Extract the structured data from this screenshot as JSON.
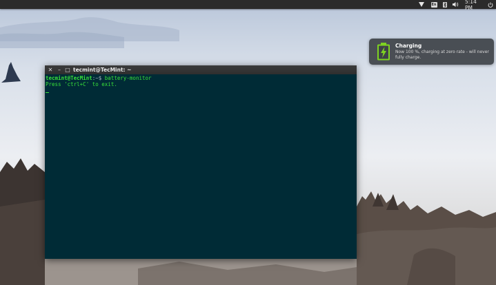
{
  "top_panel": {
    "clock": "5:14 PM",
    "keyboard_layout": "En",
    "icons": [
      "wifi-icon",
      "keyboard-layout-icon",
      "bluetooth-icon",
      "volume-icon",
      "power-icon"
    ]
  },
  "notification": {
    "title": "Charging",
    "body": "Now 100 %, charging at zero rate - will never fully charge.",
    "icon": "battery-charging-icon",
    "icon_color": "#7ed321"
  },
  "terminal": {
    "title": "tecmint@TecMint: ~",
    "buttons": {
      "close": "✕",
      "minimize": "–",
      "maximize": "□"
    },
    "prompt_user": "tecmint@TecMint",
    "prompt_path": ":~$ ",
    "command": "battery-monitor",
    "output": "Press 'ctrl+C' to exit.",
    "background": "#002b36",
    "text_color": "#39e239"
  }
}
